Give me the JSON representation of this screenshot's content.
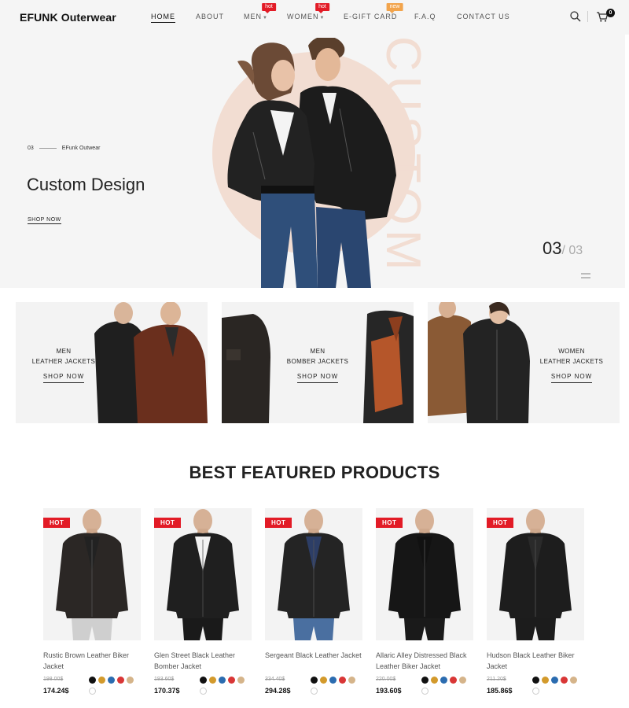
{
  "header": {
    "logo": "EFUNK Outerwear",
    "nav": [
      {
        "label": "HOME",
        "active": true
      },
      {
        "label": "ABOUT"
      },
      {
        "label": "MEN",
        "badge": "hot",
        "dropdown": true
      },
      {
        "label": "WOMEN",
        "badge": "hot",
        "dropdown": true
      },
      {
        "label": "E-GIFT CARD",
        "badge": "new"
      },
      {
        "label": "F.A.Q"
      },
      {
        "label": "CONTACT US"
      }
    ],
    "icons": [
      "search-icon",
      "cart-icon"
    ],
    "cart_count": "0"
  },
  "hero": {
    "slide_number": "03",
    "eyebrow": "EFunk Outwear",
    "title": "Custom Design",
    "cta": "SHOP NOW",
    "watermark": "CUSTOM",
    "counter_current": "03",
    "counter_total": "/ 03"
  },
  "categories": [
    {
      "line1": "MEN",
      "line2": "LEATHER JACKETS",
      "cta": "SHOP NOW"
    },
    {
      "line1": "MEN",
      "line2": "BOMBER JACKETS",
      "cta": "SHOP NOW"
    },
    {
      "line1": "WOMEN",
      "line2": "LEATHER JACKETS",
      "cta": "SHOP NOW"
    }
  ],
  "featured": {
    "title": "BEST FEATURED PRODUCTS",
    "tag": "HOT",
    "swatch_colors": [
      "#111111",
      "#d39a2c",
      "#2b6cb0",
      "#d93636",
      "#d5b48a"
    ],
    "products": [
      {
        "name": "Rustic Brown Leather Biker Jacket",
        "old_price": "198.00$",
        "price": "174.24$"
      },
      {
        "name": "Glen Street Black Leather Bomber Jacket",
        "old_price": "193.60$",
        "price": "170.37$"
      },
      {
        "name": "Sergeant Black Leather Jacket",
        "old_price": "334.40$",
        "price": "294.28$"
      },
      {
        "name": "Allaric Alley Distressed Black Leather Biker Jacket",
        "old_price": "220.00$",
        "price": "193.60$"
      },
      {
        "name": "Hudson Black Leather Biker Jacket",
        "old_price": "211.20$",
        "price": "185.86$"
      }
    ]
  }
}
